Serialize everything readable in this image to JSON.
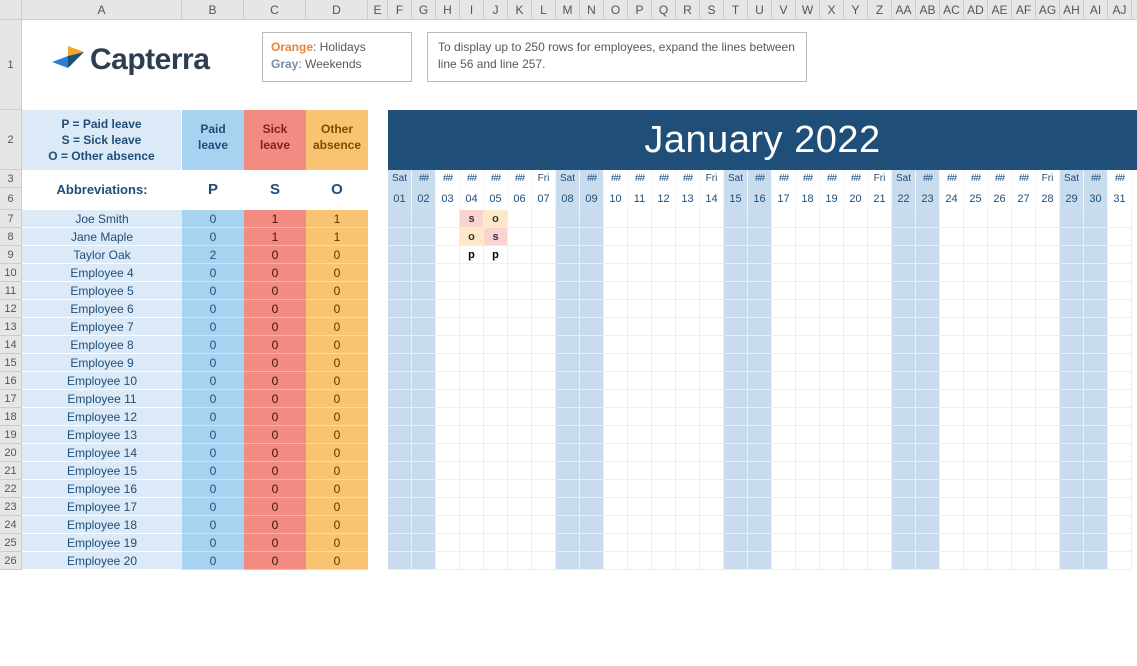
{
  "logo_text": "Capterra",
  "legend": {
    "orange_label": "Orange",
    "orange_desc": ": Holidays",
    "gray_label": "Gray",
    "gray_desc": ": Weekends"
  },
  "note": "To display up to 250 rows for employees, expand the lines between line 56 and line 257.",
  "abbrev_key_lines": [
    "P = Paid leave",
    "S = Sick leave",
    "O = Other absence"
  ],
  "abbrev_title": "Abbreviations:",
  "header_paid": "Paid leave",
  "header_sick": "Sick leave",
  "header_other": "Other absence",
  "abbr_P": "P",
  "abbr_S": "S",
  "abbr_O": "O",
  "month_title": "January 2022",
  "col_letters": [
    "A",
    "B",
    "C",
    "D",
    "E",
    "F",
    "G",
    "H",
    "I",
    "J",
    "K",
    "L",
    "M",
    "N",
    "O",
    "P",
    "Q",
    "R",
    "S",
    "T",
    "U",
    "V",
    "W",
    "X",
    "Y",
    "Z",
    "AA",
    "AB",
    "AC",
    "AD",
    "AE",
    "AF",
    "AG",
    "AH",
    "AI",
    "AJ"
  ],
  "row_numbers": [
    "1",
    "2",
    "3",
    "6",
    "7",
    "8",
    "9",
    "10",
    "11",
    "12",
    "13",
    "14",
    "15",
    "16",
    "17",
    "18",
    "19",
    "20",
    "21",
    "22",
    "23",
    "24",
    "25",
    "26"
  ],
  "day_labels": [
    "Sat",
    "##",
    "##",
    "##",
    "##",
    "##",
    "Fri",
    "Sat",
    "##",
    "##",
    "##",
    "##",
    "##",
    "Fri",
    "Sat",
    "##",
    "##",
    "##",
    "##",
    "##",
    "Fri",
    "Sat",
    "##",
    "##",
    "##",
    "##",
    "##",
    "Fri",
    "Sat",
    "##",
    "##"
  ],
  "day_numbers": [
    "01",
    "02",
    "03",
    "04",
    "05",
    "06",
    "07",
    "08",
    "09",
    "10",
    "11",
    "12",
    "13",
    "14",
    "15",
    "16",
    "17",
    "18",
    "19",
    "20",
    "21",
    "22",
    "23",
    "24",
    "25",
    "26",
    "27",
    "28",
    "29",
    "30",
    "31"
  ],
  "weekend_days": [
    1,
    2,
    8,
    9,
    15,
    16,
    22,
    23,
    29,
    30
  ],
  "employees": [
    {
      "name": "Joe Smith",
      "p": 0,
      "s": 1,
      "o": 1,
      "marks": {
        "4": "s",
        "5": "o"
      }
    },
    {
      "name": "Jane Maple",
      "p": 0,
      "s": 1,
      "o": 1,
      "marks": {
        "4": "o",
        "5": "s"
      }
    },
    {
      "name": "Taylor Oak",
      "p": 2,
      "s": 0,
      "o": 0,
      "marks": {
        "4": "p",
        "5": "p"
      }
    },
    {
      "name": "Employee 4",
      "p": 0,
      "s": 0,
      "o": 0,
      "marks": {}
    },
    {
      "name": "Employee 5",
      "p": 0,
      "s": 0,
      "o": 0,
      "marks": {}
    },
    {
      "name": "Employee 6",
      "p": 0,
      "s": 0,
      "o": 0,
      "marks": {}
    },
    {
      "name": "Employee 7",
      "p": 0,
      "s": 0,
      "o": 0,
      "marks": {}
    },
    {
      "name": "Employee 8",
      "p": 0,
      "s": 0,
      "o": 0,
      "marks": {}
    },
    {
      "name": "Employee 9",
      "p": 0,
      "s": 0,
      "o": 0,
      "marks": {}
    },
    {
      "name": "Employee 10",
      "p": 0,
      "s": 0,
      "o": 0,
      "marks": {}
    },
    {
      "name": "Employee 11",
      "p": 0,
      "s": 0,
      "o": 0,
      "marks": {}
    },
    {
      "name": "Employee 12",
      "p": 0,
      "s": 0,
      "o": 0,
      "marks": {}
    },
    {
      "name": "Employee 13",
      "p": 0,
      "s": 0,
      "o": 0,
      "marks": {}
    },
    {
      "name": "Employee 14",
      "p": 0,
      "s": 0,
      "o": 0,
      "marks": {}
    },
    {
      "name": "Employee 15",
      "p": 0,
      "s": 0,
      "o": 0,
      "marks": {}
    },
    {
      "name": "Employee 16",
      "p": 0,
      "s": 0,
      "o": 0,
      "marks": {}
    },
    {
      "name": "Employee 17",
      "p": 0,
      "s": 0,
      "o": 0,
      "marks": {}
    },
    {
      "name": "Employee 18",
      "p": 0,
      "s": 0,
      "o": 0,
      "marks": {}
    },
    {
      "name": "Employee 19",
      "p": 0,
      "s": 0,
      "o": 0,
      "marks": {}
    },
    {
      "name": "Employee 20",
      "p": 0,
      "s": 0,
      "o": 0,
      "marks": {}
    }
  ]
}
